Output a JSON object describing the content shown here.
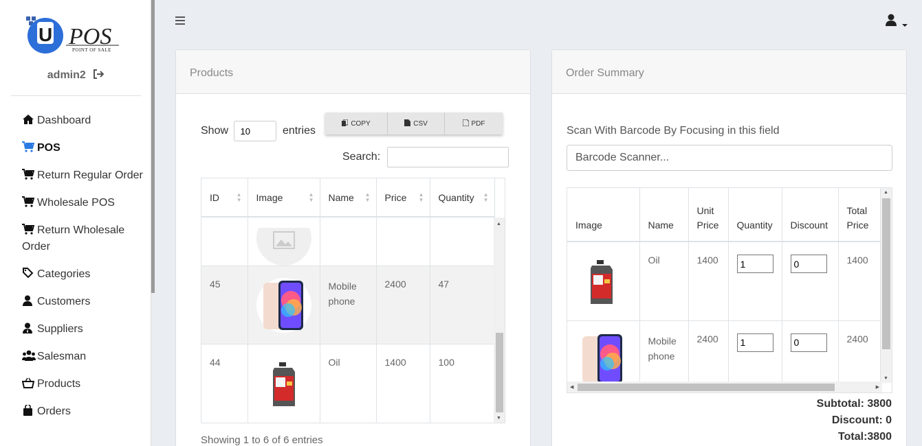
{
  "sidebar": {
    "logo_text": "POS",
    "logo_subtext": "POINT OF SALE",
    "username": "admin2",
    "items": [
      {
        "label": "Dashboard",
        "icon": "home-icon",
        "active": false
      },
      {
        "label": "POS",
        "icon": "cart-icon",
        "active": true
      },
      {
        "label": "Return Regular Order",
        "icon": "cart-icon",
        "active": false
      },
      {
        "label": "Wholesale POS",
        "icon": "cart-icon",
        "active": false
      },
      {
        "label": "Return Wholesale Order",
        "icon": "cart-icon",
        "active": false
      },
      {
        "label": "Categories",
        "icon": "tags-icon",
        "active": false
      },
      {
        "label": "Customers",
        "icon": "user-icon",
        "active": false
      },
      {
        "label": "Suppliers",
        "icon": "user-tie-icon",
        "active": false
      },
      {
        "label": "Salesman",
        "icon": "users-icon",
        "active": false
      },
      {
        "label": "Products",
        "icon": "basket-icon",
        "active": false
      },
      {
        "label": "Orders",
        "icon": "bag-icon",
        "active": false
      }
    ]
  },
  "products": {
    "title": "Products",
    "show_label": "Show",
    "entries_value": "10",
    "entries_label": "entries",
    "buttons": {
      "copy": "COPY",
      "csv": "CSV",
      "pdf": "PDF"
    },
    "search_label": "Search:",
    "columns": [
      "ID",
      "Image",
      "Name",
      "Price",
      "Quantity"
    ],
    "rows": [
      {
        "id": "",
        "name": "",
        "price": "",
        "qty": "",
        "image": "placeholder-image"
      },
      {
        "id": "45",
        "name": "Mobile phone",
        "price": "2400",
        "qty": "47",
        "image": "mobile-phone-image"
      },
      {
        "id": "44",
        "name": "Oil",
        "price": "1400",
        "qty": "100",
        "image": "oil-can-image"
      }
    ],
    "showing": "Showing 1 to 6 of 6 entries"
  },
  "order": {
    "title": "Order Summary",
    "scan_label": "Scan With Barcode By Focusing in this field",
    "barcode_placeholder": "Barcode Scanner...",
    "columns": {
      "image": "Image",
      "name": "Name",
      "unit_price": "Unit Price",
      "quantity": "Quantity",
      "discount": "Discount",
      "total_price": "Total Price"
    },
    "rows": [
      {
        "name": "Oil",
        "unit_price": "1400",
        "quantity": "1",
        "discount": "0",
        "total": "1400",
        "image": "oil-can-image"
      },
      {
        "name": "Mobile phone",
        "unit_price": "2400",
        "quantity": "1",
        "discount": "0",
        "total": "2400",
        "image": "mobile-phone-image"
      }
    ],
    "subtotal": "Subtotal: 3800",
    "discount": "Discount: 0",
    "total": "Total:3800"
  }
}
